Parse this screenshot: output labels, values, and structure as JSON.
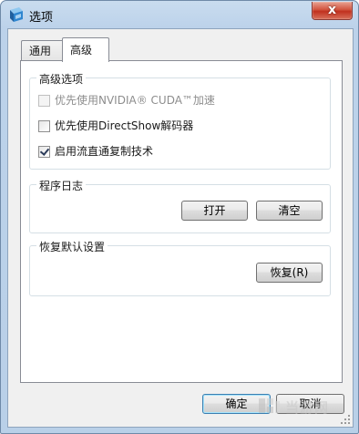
{
  "window": {
    "title": "选项",
    "close_label": "x"
  },
  "tabs": [
    {
      "label": "通用",
      "active": false
    },
    {
      "label": "高级",
      "active": true
    }
  ],
  "advanced": {
    "group_title": "高级选项",
    "options": [
      {
        "label": "优先使用NVIDIA® CUDA™加速",
        "checked": false,
        "enabled": false
      },
      {
        "label": "优先使用DirectShow解码器",
        "checked": false,
        "enabled": true
      },
      {
        "label": "启用流直通复制技术",
        "checked": true,
        "enabled": true
      }
    ]
  },
  "log": {
    "group_title": "程序日志",
    "open_label": "打开",
    "clear_label": "清空"
  },
  "reset": {
    "group_title": "恢复默认设置",
    "restore_label": "恢复(R)"
  },
  "footer": {
    "ok_label": "确定",
    "cancel_label": "取消"
  },
  "colors": {
    "titlebar": "#bcd2ea",
    "close_button": "#c0311f",
    "dialog_bg": "#f0f0f0",
    "default_button_border": "#3c7fb1"
  }
}
